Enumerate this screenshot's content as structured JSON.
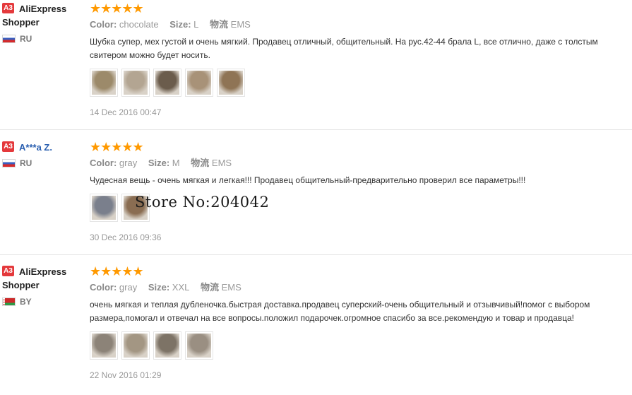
{
  "reviews": [
    {
      "badge": "A3",
      "name": "AliExpress",
      "name_line2": "Shopper",
      "country": "RU",
      "stars": "★★★★★",
      "color_label": "Color:",
      "color": "chocolate",
      "size_label": "Size:",
      "size": "L",
      "ship_label": "物流",
      "ship": "EMS",
      "text": "Шубка супер, мех густой и очень мягкий. Продавец отличный, общительный. На рус.42-44 брала L, все отлично, даже с толстым свитером можно будет носить.",
      "date": "14 Dec 2016 00:47",
      "photo_colors": [
        "#9c8a6a",
        "#b3a592",
        "#6b5c4c",
        "#a89278",
        "#8f7455"
      ]
    },
    {
      "badge": "A3",
      "name": "A***a Z.",
      "country": "RU",
      "stars": "★★★★★",
      "color_label": "Color:",
      "color": "gray",
      "size_label": "Size:",
      "size": "M",
      "ship_label": "物流",
      "ship": "EMS",
      "text": "Чудесная вещь - очень мягкая и легкая!!! Продавец общительный-предварительно проверил все параметры!!!",
      "date": "30 Dec 2016 09:36",
      "photo_colors": [
        "#7a7f8c",
        "#8a6d52"
      ]
    },
    {
      "badge": "A3",
      "name": "AliExpress",
      "name_line2": "Shopper",
      "country": "BY",
      "stars": "★★★★★",
      "color_label": "Color:",
      "color": "gray",
      "size_label": "Size:",
      "size": "XXL",
      "ship_label": "物流",
      "ship": "EMS",
      "text": "очень мягкая и теплая дубленочка.быстрая доставка.продавец суперский-очень общительный и отзывчивый!помог с выбором размера,помогал и отвечал на все вопросы.положил подарочек.огромное спасибо за все.рекомендую и товар и продавца!",
      "date": "22 Nov 2016 01:29",
      "photo_colors": [
        "#8c8378",
        "#a39683",
        "#7d7366",
        "#9a8f82"
      ]
    }
  ],
  "watermark": "Store No:204042"
}
